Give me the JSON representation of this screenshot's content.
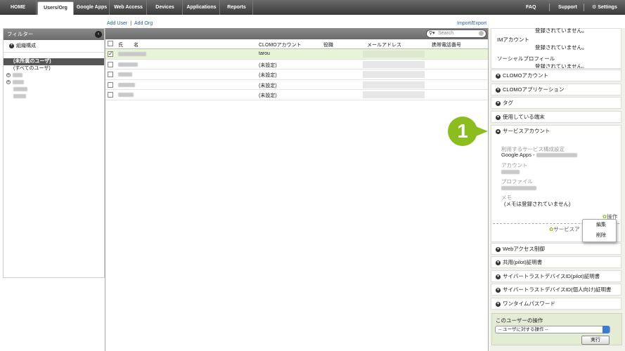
{
  "topnav": {
    "items": [
      "HOME",
      "Users/Org",
      "Google Apps",
      "Web Access",
      "Devices",
      "Applications",
      "Reports"
    ],
    "right": [
      "FAQ",
      "Support",
      "Settings"
    ]
  },
  "toolbar": {
    "add_user": "Add User",
    "add_org": "Add Org",
    "import_export": "Import/Export"
  },
  "sidebar": {
    "title": "フィルター",
    "org_label": "組織構成",
    "tree": [
      "(未所属のユーザ)",
      "(すべてのユーザ)"
    ]
  },
  "search": {
    "placeholder": "Search"
  },
  "table": {
    "columns": [
      "氏",
      "名",
      "CLOMOアカウント",
      "役職",
      "メールアドレス",
      "携帯電話番号"
    ],
    "rows": [
      {
        "account": "tarou",
        "selected": true
      },
      {
        "account": "(未設定)"
      },
      {
        "account": "(未設定)"
      },
      {
        "account": "(未設定)"
      },
      {
        "account": "(未設定)"
      }
    ]
  },
  "details": {
    "top_text": [
      "登録されていません。",
      "IMアカウント",
      "登録されていません。",
      "ソーシャルプロフィール",
      "登録されていません。"
    ],
    "sections": [
      "CLOMOアカウント",
      "CLOMOアプリケーション",
      "タグ",
      "使用している端末",
      "サービスアカウント"
    ],
    "service": {
      "label_service": "利用するサービス構成設定",
      "value_service": "Google Apps -",
      "label_account": "アカウント",
      "label_profile": "プロファイル",
      "label_memo": "メモ",
      "value_memo": "(メモは登録されていません)",
      "ops": "操作",
      "service_ac": "サービスア"
    },
    "lower_sections": [
      "Webアクセス制御",
      "共用(pilot)証明書",
      "サイバートラストデバイスID(pilot)証明書",
      "サイバートラストデバイスID(個人向け)証明書",
      "ワンタイムパスワード"
    ]
  },
  "menu": {
    "edit": "編集",
    "delete": "削除"
  },
  "callout": "1",
  "user_ops": {
    "title": "このユーザーの操作",
    "select_value": "-- ユーザに対する操作 --",
    "run": "実行"
  },
  "colors": {
    "accent": "#8cbd1f",
    "selected_row": "#e9f3d6",
    "link": "#2a5c9a"
  }
}
